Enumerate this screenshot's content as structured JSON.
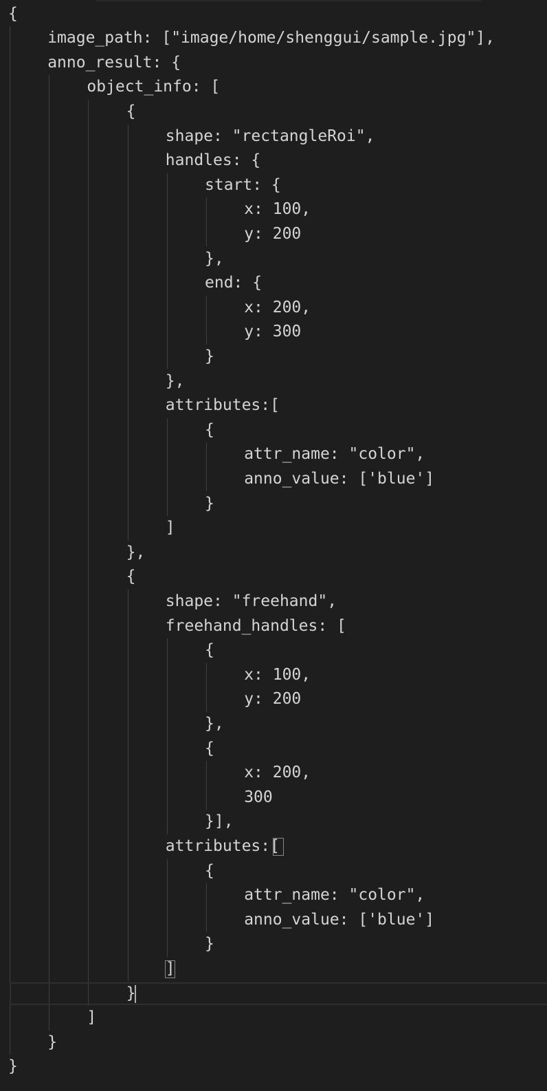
{
  "editor": {
    "lines": [
      {
        "indent": 0,
        "text": "{"
      },
      {
        "indent": 1,
        "text": "image_path: [\"image/home/shenggui/sample.jpg\"],"
      },
      {
        "indent": 1,
        "text": "anno_result: {"
      },
      {
        "indent": 2,
        "text": "object_info: ["
      },
      {
        "indent": 3,
        "text": "{"
      },
      {
        "indent": 4,
        "text": "shape: \"rectangleRoi\","
      },
      {
        "indent": 4,
        "text": "handles: {"
      },
      {
        "indent": 5,
        "text": "start: {"
      },
      {
        "indent": 6,
        "text": "x: 100,"
      },
      {
        "indent": 6,
        "text": "y: 200"
      },
      {
        "indent": 5,
        "text": "},"
      },
      {
        "indent": 5,
        "text": "end: {"
      },
      {
        "indent": 6,
        "text": "x: 200,"
      },
      {
        "indent": 6,
        "text": "y: 300"
      },
      {
        "indent": 5,
        "text": "}"
      },
      {
        "indent": 4,
        "text": "},"
      },
      {
        "indent": 4,
        "text": "attributes:["
      },
      {
        "indent": 5,
        "text": "{"
      },
      {
        "indent": 6,
        "text": "attr_name: \"color\","
      },
      {
        "indent": 6,
        "text": "anno_value: ['blue']"
      },
      {
        "indent": 5,
        "text": "}"
      },
      {
        "indent": 4,
        "text": "]"
      },
      {
        "indent": 3,
        "text": "},"
      },
      {
        "indent": 3,
        "text": "{"
      },
      {
        "indent": 4,
        "text": "shape: \"freehand\","
      },
      {
        "indent": 4,
        "text": "freehand_handles: ["
      },
      {
        "indent": 5,
        "text": "{"
      },
      {
        "indent": 6,
        "text": "x: 100,"
      },
      {
        "indent": 6,
        "text": "y: 200"
      },
      {
        "indent": 5,
        "text": "},"
      },
      {
        "indent": 5,
        "text": "{"
      },
      {
        "indent": 6,
        "text": "x: 200,"
      },
      {
        "indent": 6,
        "text": "300"
      },
      {
        "indent": 5,
        "text": "}],"
      },
      {
        "indent": 4,
        "text": "attributes:["
      },
      {
        "indent": 5,
        "text": "{"
      },
      {
        "indent": 6,
        "text": "attr_name: \"color\","
      },
      {
        "indent": 6,
        "text": "anno_value: ['blue']"
      },
      {
        "indent": 5,
        "text": "}"
      },
      {
        "indent": 4,
        "text": "]"
      },
      {
        "indent": 3,
        "text": "}"
      },
      {
        "indent": 2,
        "text": "]"
      },
      {
        "indent": 1,
        "text": "}"
      },
      {
        "indent": 0,
        "text": "}"
      }
    ],
    "cursor_line": 40,
    "colors": {
      "background": "#1e1e1e",
      "text": "#d4d4d4",
      "indent_guide": "#404040",
      "active_indent_guide": "#707070",
      "current_line_border": "#2f2f2f",
      "bracket_match_border": "#8a8a8a"
    }
  }
}
